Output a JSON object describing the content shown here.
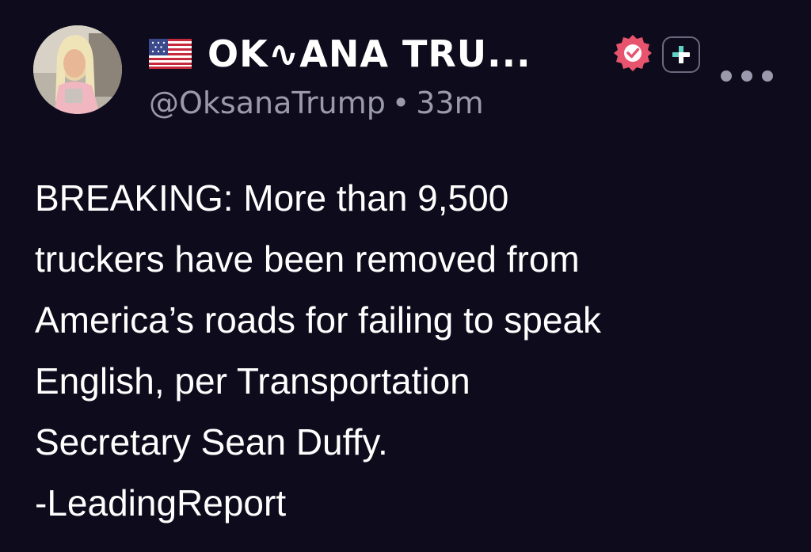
{
  "author": {
    "flag_icon": "us-flag-icon",
    "display_name": "OK∿ANA TRU...",
    "handle": "@OksanaTrump",
    "separator": "•",
    "timestamp": "33m",
    "verified_icon": "verified-check-icon",
    "follow_icon": "plus-icon",
    "more_icon": "more-dots-icon"
  },
  "post": {
    "lines": [
      "BREAKING: More than 9,500",
      "truckers have been removed from",
      "America’s roads for failing to speak",
      "English, per Transportation",
      "Secretary Sean Duffy.",
      "-LeadingReport"
    ]
  },
  "colors": {
    "background": "#0e0c1c",
    "text": "#ffffff",
    "muted": "#9b99ac",
    "verified": "#e8546e",
    "plus_accent": "#5fd3c6"
  }
}
